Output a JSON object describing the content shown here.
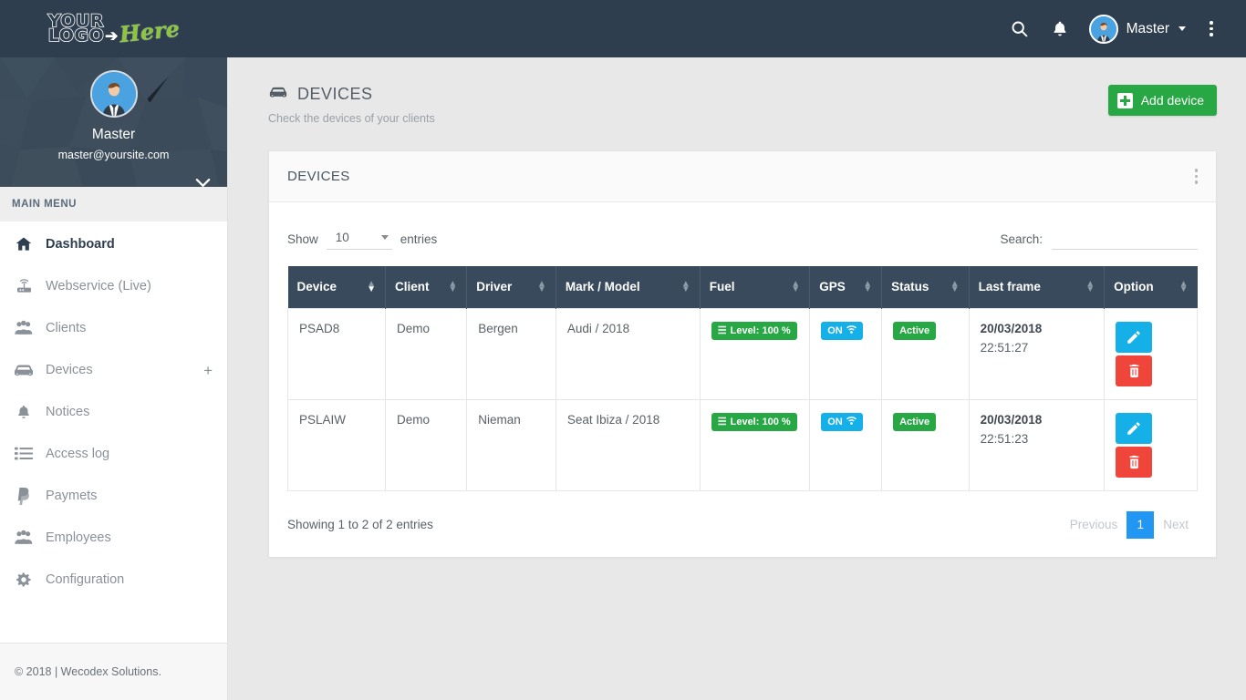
{
  "navbar": {
    "logo_line1": "YOUR",
    "logo_line2": "LOGO",
    "logo_arrow": "➔",
    "logo_accent": "Here",
    "search_icon": "search-icon",
    "bell_icon": "bell-icon",
    "username": "Master",
    "kebab_icon": "more-vertical-icon"
  },
  "sidebar": {
    "profile": {
      "name": "Master",
      "email": "master@yoursite.com",
      "caret": "⌄"
    },
    "menu_title": "MAIN MENU",
    "items": [
      {
        "label": "Dashboard",
        "icon": "home-icon",
        "active": true,
        "plus": ""
      },
      {
        "label": "Webservice (Live)",
        "icon": "router-icon",
        "active": false,
        "plus": ""
      },
      {
        "label": "Clients",
        "icon": "users-icon",
        "active": false,
        "plus": ""
      },
      {
        "label": "Devices",
        "icon": "car-icon",
        "active": false,
        "plus": "+"
      },
      {
        "label": "Notices",
        "icon": "bell-icon",
        "active": false,
        "plus": ""
      },
      {
        "label": "Access log",
        "icon": "list-icon",
        "active": false,
        "plus": ""
      },
      {
        "label": "Paymets",
        "icon": "paypal-icon",
        "active": false,
        "plus": ""
      },
      {
        "label": "Employees",
        "icon": "users-icon",
        "active": false,
        "plus": ""
      },
      {
        "label": "Configuration",
        "icon": "gear-icon",
        "active": false,
        "plus": ""
      }
    ],
    "footer": "© 2018 | Wecodex Solutions."
  },
  "page": {
    "title": "DEVICES",
    "title_icon": "car-icon",
    "subtitle": "Check the devices of your clients",
    "add_button": "Add device"
  },
  "card": {
    "title": "DEVICES",
    "menu_icon": "more-vertical-icon"
  },
  "table_controls": {
    "show_label": "Show",
    "entries_label": "entries",
    "page_length": "10",
    "search_label": "Search:",
    "search_value": "",
    "search_placeholder": ""
  },
  "table": {
    "columns": [
      {
        "label": "Device",
        "sort": "asc"
      },
      {
        "label": "Client",
        "sort": "none"
      },
      {
        "label": "Driver",
        "sort": "none"
      },
      {
        "label": "Mark / Model",
        "sort": "none"
      },
      {
        "label": "Fuel",
        "sort": "none"
      },
      {
        "label": "GPS",
        "sort": "none"
      },
      {
        "label": "Status",
        "sort": "none"
      },
      {
        "label": "Last frame",
        "sort": "none"
      },
      {
        "label": "Option",
        "sort": "none"
      }
    ],
    "rows": [
      {
        "device": "PSAD8",
        "client": "Demo",
        "driver": "Bergen",
        "mark_model": "Audi / 2018",
        "fuel": "Level: 100 %",
        "gps": "ON",
        "status": "Active",
        "last_frame_date": "20/03/2018",
        "last_frame_time": "22:51:27",
        "edit_icon": "pencil-icon",
        "delete_icon": "trash-icon"
      },
      {
        "device": "PSLAIW",
        "client": "Demo",
        "driver": "Nieman",
        "mark_model": "Seat Ibiza / 2018",
        "fuel": "Level: 100 %",
        "gps": "ON",
        "status": "Active",
        "last_frame_date": "20/03/2018",
        "last_frame_time": "22:51:23",
        "edit_icon": "pencil-icon",
        "delete_icon": "trash-icon"
      }
    ]
  },
  "table_footer": {
    "info": "Showing 1 to 2 of 2 entries",
    "previous": "Previous",
    "current_page": "1",
    "next": "Next"
  },
  "colors": {
    "navbar": "#2e3e4e",
    "sidebar_profile": "#3c4c5a",
    "table_header": "#384a5c",
    "accent_green": "#27a844",
    "accent_blue": "#16b0e8",
    "accent_red": "#f0453a",
    "pagination_blue": "#2196f3",
    "logo_green": "#8cc63e"
  }
}
